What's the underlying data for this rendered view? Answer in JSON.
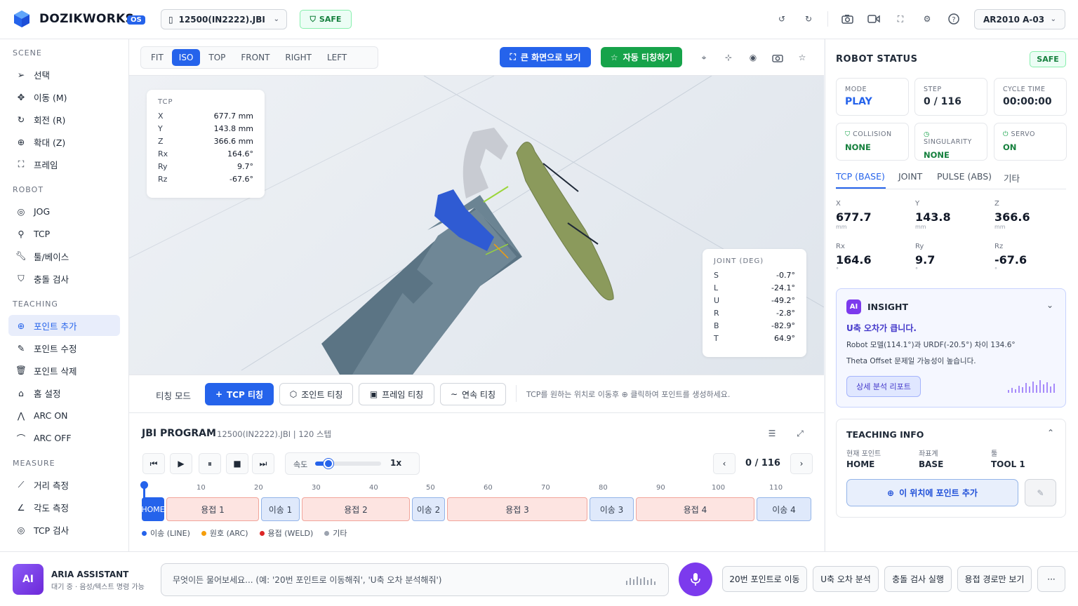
{
  "header": {
    "brand": "DOZIKWORKS",
    "os_badge": "OS",
    "file_name": "12500(IN2222).JBI",
    "safe_label": "SAFE",
    "robot_model": "AR2010 A-03"
  },
  "sidebar": {
    "sections": {
      "scene": "SCENE",
      "robot": "ROBOT",
      "teaching": "TEACHING",
      "measure": "MEASURE"
    },
    "scene_items": [
      "선택",
      "이동 (M)",
      "회전 (R)",
      "확대 (Z)",
      "프레임"
    ],
    "robot_items": [
      "JOG",
      "TCP",
      "툴/베이스",
      "충돌 검사"
    ],
    "teaching_items": [
      "포인트 추가",
      "포인트 수정",
      "포인트 삭제",
      "홈 설정",
      "ARC ON",
      "ARC OFF"
    ],
    "measure_items": [
      "거리 측정",
      "각도 측정",
      "TCP 검사"
    ]
  },
  "viewport": {
    "views": [
      "FIT",
      "ISO",
      "TOP",
      "FRONT",
      "RIGHT",
      "LEFT"
    ],
    "active_view": "ISO",
    "fullscreen_label": "큰 화면으로 보기",
    "auto_teach_label": "자동 티칭하기",
    "tcp_panel": {
      "title": "TCP",
      "rows": [
        {
          "k": "X",
          "v": "677.7 mm"
        },
        {
          "k": "Y",
          "v": "143.8 mm"
        },
        {
          "k": "Z",
          "v": "366.6 mm"
        },
        {
          "k": "Rx",
          "v": "164.6°"
        },
        {
          "k": "Ry",
          "v": "9.7°"
        },
        {
          "k": "Rz",
          "v": "-67.6°"
        }
      ]
    },
    "joint_panel": {
      "title": "JOINT (DEG)",
      "rows": [
        {
          "k": "S",
          "v": "-0.7°"
        },
        {
          "k": "L",
          "v": "-24.1°"
        },
        {
          "k": "U",
          "v": "-49.2°"
        },
        {
          "k": "R",
          "v": "-2.8°"
        },
        {
          "k": "B",
          "v": "-82.9°"
        },
        {
          "k": "T",
          "v": "64.9°"
        }
      ]
    }
  },
  "teach_bar": {
    "mode_label": "티칭 모드",
    "tcp_teach": "TCP 티칭",
    "joint_teach": "조인트 티칭",
    "frame_teach": "프레임 티칭",
    "continuous_teach": "연속 티칭",
    "hint": "TCP를 원하는 위치로 이동후 ⊕ 클릭하여 포인트를 생성하세요."
  },
  "program": {
    "title": "JBI PROGRAM",
    "subtitle": "12500(IN2222).JBI | 120 스텝",
    "speed_label": "속도",
    "speed_value": "1x",
    "speed_fraction": 0.2,
    "step_display": "0 / 116",
    "ticks": [
      "10",
      "20",
      "30",
      "40",
      "50",
      "60",
      "70",
      "80",
      "90",
      "100",
      "110"
    ],
    "segments": [
      {
        "label": "HOME",
        "kind": "home"
      },
      {
        "label": "용접 1",
        "kind": "weld"
      },
      {
        "label": "이송 1",
        "kind": "move"
      },
      {
        "label": "용접 2",
        "kind": "weld"
      },
      {
        "label": "이송 2",
        "kind": "move"
      },
      {
        "label": "용접 3",
        "kind": "weld"
      },
      {
        "label": "이송 3",
        "kind": "move"
      },
      {
        "label": "용접 4",
        "kind": "weld"
      },
      {
        "label": "이송 4",
        "kind": "move"
      }
    ],
    "legend": [
      {
        "label": "이송 (LINE)",
        "color": "#2563eb"
      },
      {
        "label": "원호 (ARC)",
        "color": "#f59e0b"
      },
      {
        "label": "용접 (WELD)",
        "color": "#dc2626"
      },
      {
        "label": "기타",
        "color": "#9ca3af"
      }
    ]
  },
  "robot_status": {
    "title": "ROBOT STATUS",
    "badge": "SAFE",
    "mode_label": "MODE",
    "mode_value": "PLAY",
    "step_label": "STEP",
    "step_value": "0 / 116",
    "cycle_label": "CYCLE TIME",
    "cycle_value": "00:00:00",
    "collision_label": "COLLISION",
    "collision_value": "NONE",
    "singularity_label": "SINGULARITY",
    "singularity_value": "NONE",
    "servo_label": "SERVO",
    "servo_value": "ON",
    "tabs": [
      "TCP (BASE)",
      "JOINT",
      "PULSE (ABS)",
      "기타"
    ],
    "pose": [
      {
        "k": "X",
        "v": "677.7",
        "u": "mm"
      },
      {
        "k": "Y",
        "v": "143.8",
        "u": "mm"
      },
      {
        "k": "Z",
        "v": "366.6",
        "u": "mm"
      },
      {
        "k": "Rx",
        "v": "164.6",
        "u": "°"
      },
      {
        "k": "Ry",
        "v": "9.7",
        "u": "°"
      },
      {
        "k": "Rz",
        "v": "-67.6",
        "u": "°"
      }
    ]
  },
  "insight": {
    "badge": "AI",
    "title": "INSIGHT",
    "headline": "U축 오차가 큽니다.",
    "line1": "Robot 모델(114.1°)과 URDF(-20.5°) 차이 134.6°",
    "line2": "Theta Offset 문제일 가능성이 높습니다.",
    "report_button": "상세 분석 리포트"
  },
  "teaching_info": {
    "title": "TEACHING INFO",
    "current_point_label": "현재 포인트",
    "current_point_value": "HOME",
    "coord_label": "좌표계",
    "coord_value": "BASE",
    "tool_label": "툴",
    "tool_value": "TOOL 1",
    "add_point_button": "이 위치에 포인트 추가"
  },
  "assistant": {
    "avatar": "AI",
    "name": "ARIA ASSISTANT",
    "status": "대기 중 · 음성/텍스트 명령 가능",
    "placeholder": "무엇이든 물어보세요... (예: '20번 포인트로 이동해줘', 'U축 오차 분석해줘')",
    "quick_actions": [
      "20번 포인트로 이동",
      "U축 오차 분석",
      "충돌 검사 실행",
      "용접 경로만 보기"
    ],
    "more": "···"
  },
  "colors": {
    "accent": "#2563eb",
    "safe_green": "#15803d",
    "auto_teach_green": "#16a34a",
    "ai_purple": "#7c3aed"
  }
}
